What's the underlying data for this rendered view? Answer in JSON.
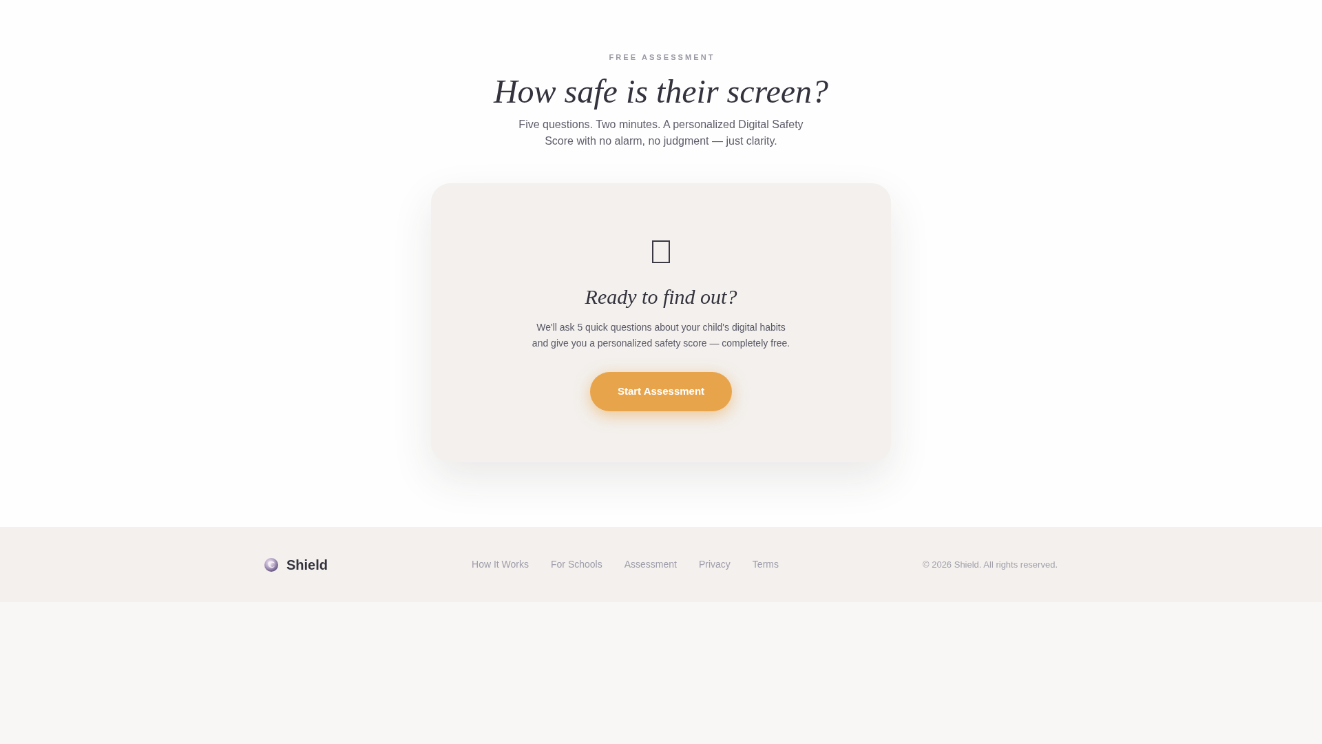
{
  "header": {
    "eyebrow": "FREE ASSESSMENT",
    "title": "How safe is their screen?",
    "subtitle": "Five questions. Two minutes. A personalized Digital Safety Score with no alarm, no judgment — just clarity."
  },
  "card": {
    "title": "Ready to find out?",
    "description": "We'll ask 5 quick questions about your child's digital habits and give you a personalized safety score — completely free.",
    "button": "Start Assessment"
  },
  "footer": {
    "brand": "Shield",
    "links": [
      "How It Works",
      "For Schools",
      "Assessment",
      "Privacy",
      "Terms"
    ],
    "copyright": "© 2026 Shield. All rights reserved."
  }
}
